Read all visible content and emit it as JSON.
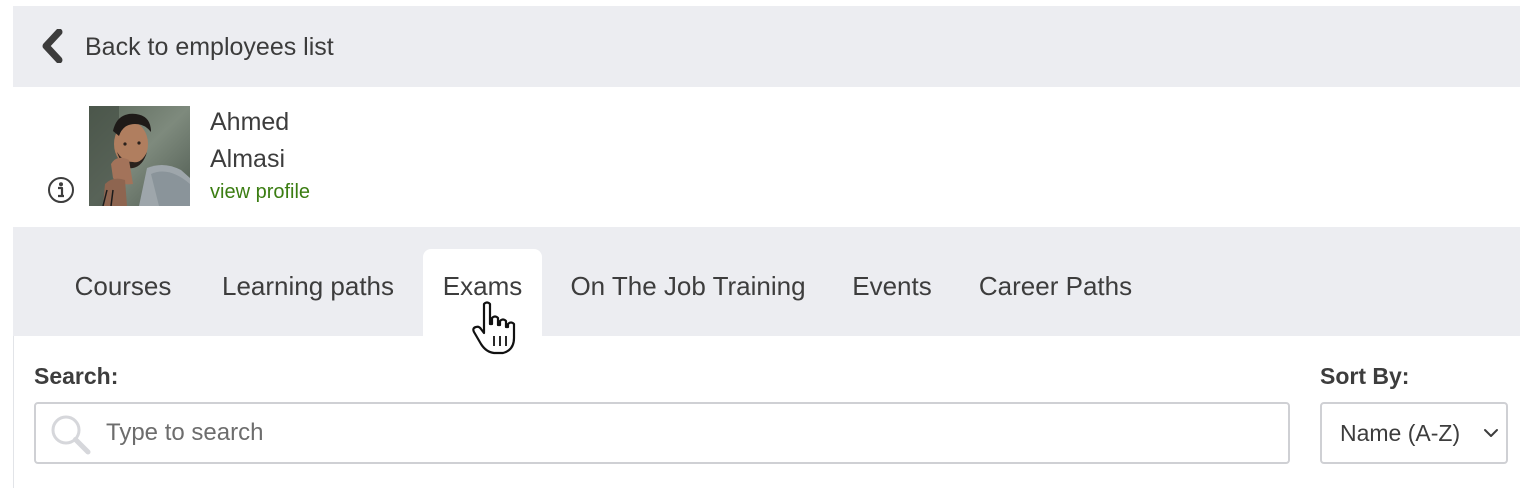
{
  "back": {
    "label": "Back to employees list",
    "icon": "chevron-left-icon"
  },
  "employee": {
    "first_name": "Ahmed",
    "last_name": "Almasi",
    "view_profile_label": "view profile",
    "info_icon": "info-icon",
    "avatar_icon": "avatar"
  },
  "tabs": [
    {
      "label": "Courses",
      "active": false
    },
    {
      "label": "Learning paths",
      "active": false
    },
    {
      "label": "Exams",
      "active": true
    },
    {
      "label": "On The Job Training",
      "active": false
    },
    {
      "label": "Events",
      "active": false
    },
    {
      "label": "Career Paths",
      "active": false
    }
  ],
  "search": {
    "label": "Search:",
    "placeholder": "Type to search",
    "value": "",
    "icon": "search-icon"
  },
  "sort": {
    "label": "Sort By:",
    "selected": "Name (A-Z)",
    "icon": "chevron-down-icon"
  },
  "colors": {
    "bar_background": "#ecedf1",
    "link_green": "#3b7d12",
    "text": "#3d3d3d",
    "border": "#cfd0d4"
  }
}
